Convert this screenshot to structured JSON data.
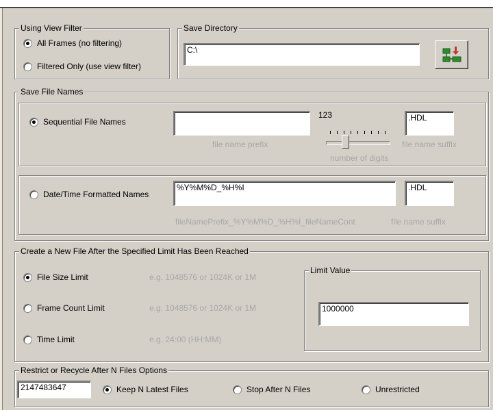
{
  "view_filter": {
    "legend": "Using View Filter",
    "options": [
      "All Frames (no filtering)",
      "Filtered Only (use view filter)"
    ],
    "selected": 0
  },
  "save_directory": {
    "legend": "Save Directory",
    "value": "C:\\",
    "browse_icon": "folder-tree-icon"
  },
  "file_names": {
    "legend": "Save File Names",
    "sequential": {
      "label": "Sequential File Names",
      "prefix_value": "",
      "prefix_hint": "file name prefix",
      "digits_preview": "123",
      "digits_hint": "number of digits",
      "suffix_value": ".HDL",
      "suffix_hint": "file name suffix"
    },
    "datetime": {
      "label": "Date/Time Formatted Names",
      "format_value": "%Y%M%D_%H%I",
      "format_hint": "fileNamePrefix_%Y%M%D_%H%I_fileNameCont",
      "suffix_value": ".HDL",
      "suffix_hint": "file name suffix"
    },
    "selected": "sequential"
  },
  "limit": {
    "legend": "Create a New File After the Specified Limit Has Been Reached",
    "options": [
      {
        "label": "File Size Limit",
        "hint": "e.g. 1048576 or 1024K or 1M"
      },
      {
        "label": "Frame Count Limit",
        "hint": "e.g. 1048576 or 1024K or 1M"
      },
      {
        "label": "Time Limit",
        "hint": "e.g. 24:00 (HH:MM)"
      }
    ],
    "selected": 0,
    "value_legend": "Limit Value",
    "value": "1000000"
  },
  "restrict": {
    "legend": "Restrict or Recycle After N Files Options",
    "n_value": "2147483647",
    "options": [
      "Keep N Latest Files",
      "Stop After N Files",
      "Unrestricted"
    ],
    "selected": 0
  },
  "colors": {
    "panel": "#d4d0c8",
    "hint_text": "#a7a7a7",
    "icon_green": "#2e8b2e",
    "icon_red": "#c0392b"
  }
}
